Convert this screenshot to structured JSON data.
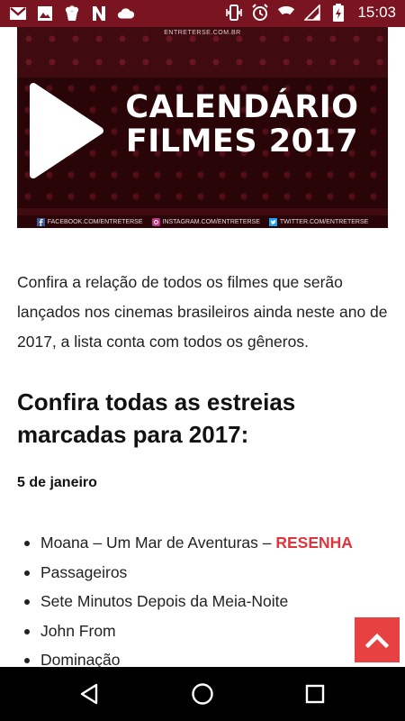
{
  "status_bar": {
    "time": "15:03",
    "icons": [
      "gmail-icon",
      "photos-icon",
      "popcorn-icon",
      "n-icon",
      "cloud-icon",
      "vibrate-icon",
      "alarm-icon",
      "wifi-icon",
      "signal-icon",
      "battery-charging-icon"
    ]
  },
  "banner": {
    "site": "ENTRETERSE.COM.BR",
    "title_line1": "CALENDÁRIO",
    "title_line2": "FILMES 2017",
    "facebook": "FACEBOOK.COM/ENTRETERSE",
    "instagram": "INSTAGRAM.COM/ENTRETERSE",
    "twitter": "TWITTER.COM/ENTRETERSE"
  },
  "article": {
    "intro": "Confira a relação de todos os filmes que serão lançados nos cinemas brasileiros ainda neste ano de 2017, a lista conta com todos os gêneros.",
    "heading": "Confira todas as estreias marcadas para 2017:",
    "date": "5 de janeiro",
    "movies": [
      {
        "title": "Moana – Um Mar de Aventuras – ",
        "link": "RESENHA"
      },
      {
        "title": "Passageiros"
      },
      {
        "title": "Sete Minutos Depois da Meia-Noite"
      },
      {
        "title": "John From"
      },
      {
        "title": "Dominação"
      }
    ]
  },
  "colors": {
    "status_bar": "#7b1421",
    "link": "#e2323a",
    "scroll_button": "#e84141"
  }
}
